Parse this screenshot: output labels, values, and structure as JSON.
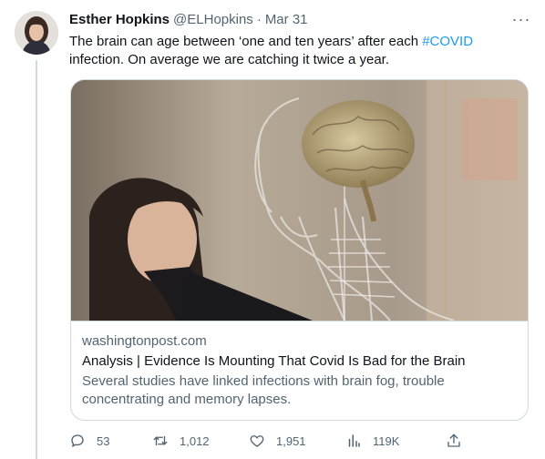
{
  "tweet": {
    "author_name": "Esther Hopkins",
    "handle": "@ELHopkins",
    "separator": "·",
    "date": "Mar 31",
    "more_label": "···",
    "text_before": "The brain can age between ‘one and ten years’ after each ",
    "hashtag": "#COVID",
    "text_after": " infection. On average we are catching it twice a year."
  },
  "card": {
    "domain": "washingtonpost.com",
    "title": "Analysis | Evidence Is Mounting That Covid Is Bad for the Brain",
    "description": "Several studies have linked infections with brain fog, trouble concentrating and memory lapses."
  },
  "actions": {
    "replies": "53",
    "retweets": "1,012",
    "likes": "1,951",
    "views": "119K"
  },
  "colors": {
    "link": "#1d9bf0",
    "secondary_text": "#536471",
    "border": "#cfd9de"
  },
  "icons": [
    "reply-icon",
    "retweet-icon",
    "like-icon",
    "views-icon",
    "share-icon",
    "more-icon"
  ]
}
